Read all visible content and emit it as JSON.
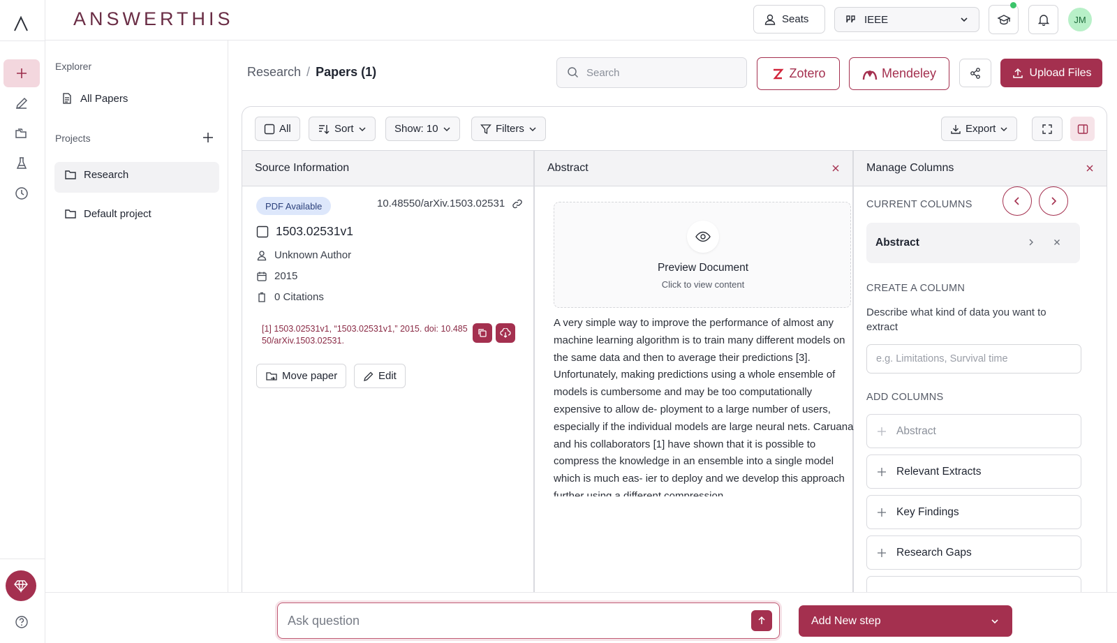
{
  "app": {
    "brand": "ANSWERTHIS",
    "user_initials": "JM",
    "accent_color": "#a4304f",
    "avatar_color": "#b8f0c8"
  },
  "header": {
    "seats_label": "Seats",
    "citation_style": "IEEE"
  },
  "explorer": {
    "title": "Explorer",
    "all_papers": "All Papers",
    "projects_title": "Projects",
    "projects": [
      {
        "label": "Research"
      },
      {
        "label": "Default project"
      }
    ]
  },
  "breadcrumb": {
    "parent": "Research",
    "separator": "/",
    "current": "Papers (1)"
  },
  "search": {
    "placeholder": "Search"
  },
  "integrations": {
    "zotero": "Zotero",
    "mendeley": "Mendeley",
    "upload": "Upload Files"
  },
  "toolbar": {
    "all": "All",
    "sort": "Sort",
    "show": "Show: 10",
    "filters": "Filters",
    "export": "Export"
  },
  "columns": {
    "source": "Source Information",
    "abstract": "Abstract",
    "manage": "Manage Columns"
  },
  "paper": {
    "badge": "PDF Available",
    "doi": "10.48550/arXiv.1503.02531",
    "title": "1503.02531v1",
    "author": "Unknown Author",
    "year": "2015",
    "citations": "0 Citations",
    "citation_line1": "[1] 1503.02531v1, “1503.02531v1,” 2015. doi: 10.485",
    "citation_line2": "50/arXiv.1503.02531.",
    "move_label": "Move paper",
    "edit_label": "Edit"
  },
  "abstract": {
    "preview_title": "Preview Document",
    "preview_sub": "Click to view content",
    "text": "A very simple way to improve the performance of almost any machine learning algorithm is to train many different models on the same data and then to average their predictions [3]. Unfortunately, making predictions using a whole ensemble of models is cumbersome and may be too computationally expensive to allow de- ployment to a large number of users, especially if the individual models are large neural nets. Caruana and his collaborators [1] have shown that it is possible to compress the knowledge in an ensemble into a single model which is much eas- ier to deploy and we develop this approach further using a different compression"
  },
  "manage": {
    "current_title": "CURRENT COLUMNS",
    "current_columns": [
      {
        "label": "Abstract"
      }
    ],
    "create_title": "CREATE A COLUMN",
    "create_desc": "Describe what kind of data you want to extract",
    "create_placeholder": "e.g. Limitations, Survival time",
    "add_title": "ADD COLUMNS",
    "add_columns": [
      {
        "label": "Abstract",
        "disabled": true
      },
      {
        "label": "Relevant Extracts"
      },
      {
        "label": "Key Findings"
      },
      {
        "label": "Research Gaps"
      }
    ]
  },
  "bottom": {
    "ask_placeholder": "Ask question",
    "add_step": "Add New step"
  }
}
